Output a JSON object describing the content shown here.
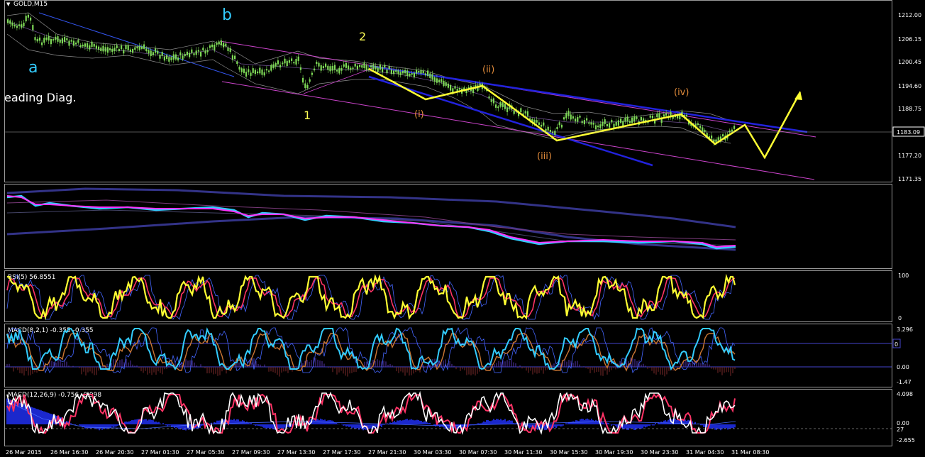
{
  "header": {
    "symbol_tf": "GOLD,M15"
  },
  "annotations": {
    "wave_a": "a",
    "wave_b": "b",
    "wave_1": "1",
    "wave_2": "2",
    "wave_i": "(i)",
    "wave_ii": "(ii)",
    "wave_iii": "(iii)",
    "wave_iv": "(iv)",
    "pattern": "eading Diag."
  },
  "price_axis": [
    "1212.00",
    "1206.15",
    "1200.45",
    "1194.60",
    "1188.75",
    "1183.09",
    "1177.20",
    "1171.35"
  ],
  "current_price": "1183.09",
  "panels": {
    "rsi": {
      "label": "RSI(5) 56.8551",
      "ticks": [
        "100",
        "0"
      ]
    },
    "macd_fast": {
      "label": "MACD(8,2,1) -0.355 -0.355",
      "ticks": [
        "3.296",
        "0",
        "0.00",
        "-1.47"
      ]
    },
    "macd_slow": {
      "label": "MACD(12,26,9) -0.756 -0.998",
      "ticks": [
        "4.098",
        "0.00",
        "27",
        "-2.655"
      ]
    }
  },
  "time_axis": [
    "26 Mar 2015",
    "26 Mar 16:30",
    "26 Mar 20:30",
    "27 Mar 01:30",
    "27 Mar 05:30",
    "27 Mar 09:30",
    "27 Mar 13:30",
    "27 Mar 17:30",
    "27 Mar 21:30",
    "30 Mar 03:30",
    "30 Mar 07:30",
    "30 Mar 11:30",
    "30 Mar 15:30",
    "30 Mar 19:30",
    "30 Mar 23:30",
    "31 Mar 04:30",
    "31 Mar 08:30"
  ],
  "colors": {
    "bg": "#000000",
    "candles": "#7ed957",
    "wave_yellow": "#ffff33",
    "channel_blue": "#2222dd",
    "channel_magenta": "#cc44cc",
    "label_cyan": "#33ccff",
    "label_orange": "#e08a3a"
  }
}
